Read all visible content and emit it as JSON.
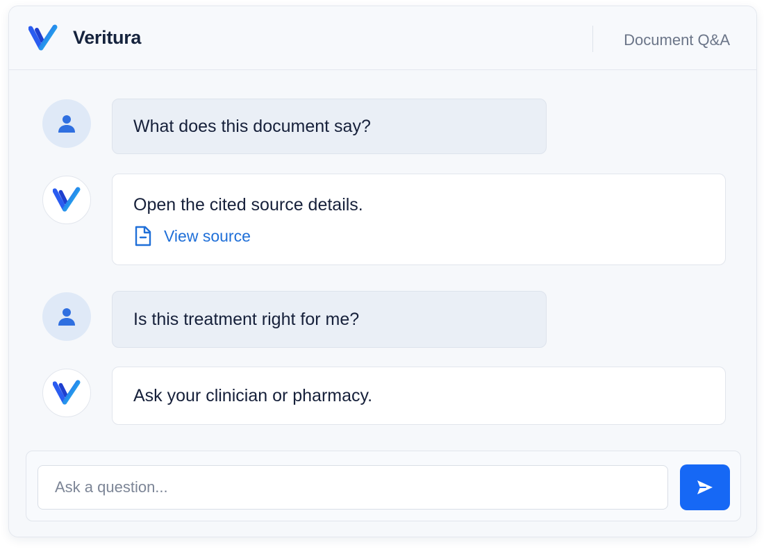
{
  "header": {
    "app_name": "Veritura",
    "mode_label": "Document Q&A",
    "logo_icon": "veritura-v-logo"
  },
  "messages": [
    {
      "role": "user",
      "avatar_icon": "person-icon",
      "text": "What does this document say?"
    },
    {
      "role": "assistant",
      "avatar_icon": "veritura-v-logo",
      "text": "Open the cited source details.",
      "link": {
        "icon": "document-icon",
        "label": "View source"
      }
    },
    {
      "role": "user",
      "avatar_icon": "person-icon",
      "text": "Is this treatment right for me?"
    },
    {
      "role": "assistant",
      "avatar_icon": "veritura-v-logo",
      "text": "Ask your clinician or pharmacy."
    }
  ],
  "composer": {
    "placeholder": "Ask a question...",
    "value": "",
    "send_icon": "send-arrow-icon"
  },
  "colors": {
    "accent": "#1668f5",
    "link": "#1f6fd8",
    "user_bubble": "#eaeff6",
    "bot_bubble": "#ffffff",
    "text": "#16203a"
  }
}
